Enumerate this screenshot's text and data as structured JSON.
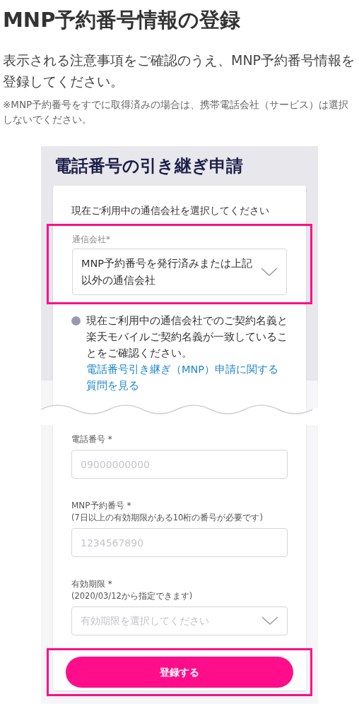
{
  "page": {
    "title": "MNP予約番号情報の登録",
    "description": "表示される注意事項をご確認のうえ、MNP予約番号情報を登録してください。",
    "note": "※MNP予約番号をすでに取得済みの場合は、携帯電話会社（サービス）は選択しないでください。"
  },
  "mockup": {
    "title": "電話番号の引き継ぎ申請",
    "intro": "現在ご利用中の通信会社を選択してください",
    "carrier_field": {
      "label": "通信会社*",
      "value": "MNP予約番号を発行済みまたは上記以外の通信会社",
      "highlighted": true
    },
    "info": {
      "text": "現在ご利用中の通信会社でのご契約名義と楽天モバイルご契約名義が一致していることをご確認ください。",
      "link": "電話番号引き継ぎ（MNP）申請に関する質問を見る"
    },
    "fields": [
      {
        "kind": "input",
        "label": "電話番号 *",
        "placeholder": "09000000000"
      },
      {
        "kind": "input",
        "label": "MNP予約番号  *",
        "sublabel": "(7日以上の有効期限がある10桁の番号が必要です)",
        "placeholder": "1234567890"
      },
      {
        "kind": "select",
        "label": "有効期限 *",
        "sublabel": "(2020/03/12から指定できます)",
        "placeholder": "有効期限を選択してください"
      }
    ],
    "submit": {
      "label": "登録する",
      "highlighted": true
    }
  }
}
